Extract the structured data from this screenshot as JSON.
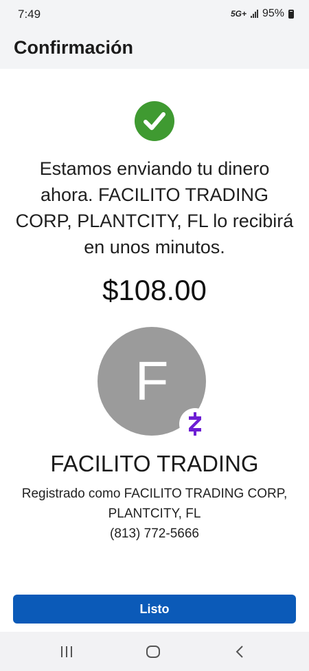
{
  "status_bar": {
    "time": "7:49",
    "network": "5G+",
    "battery": "95%"
  },
  "app_bar": {
    "title": "Confirmación"
  },
  "confirmation": {
    "icon": "check-circle-icon",
    "message": "Estamos enviando tu dinero ahora. FACILITO TRADING CORP, PLANTCITY, FL lo recibirá en unos minutos.",
    "amount": "$108.00"
  },
  "recipient": {
    "avatar_letter": "F",
    "name": "FACILITO TRADING",
    "registered_line1": "Registrado como FACILITO TRADING CORP,",
    "registered_line2": "PLANTCITY, FL",
    "phone": "(813) 772-5666",
    "badge_icon": "zelle-icon"
  },
  "actions": {
    "done_label": "Listo"
  },
  "colors": {
    "success": "#3f9a31",
    "primary_button": "#0b5ab8",
    "avatar_bg": "#9b9b9b",
    "zelle_purple": "#6d1ed4"
  },
  "nav_bar": {
    "icons": [
      "recent-apps-icon",
      "home-icon",
      "back-icon"
    ]
  }
}
